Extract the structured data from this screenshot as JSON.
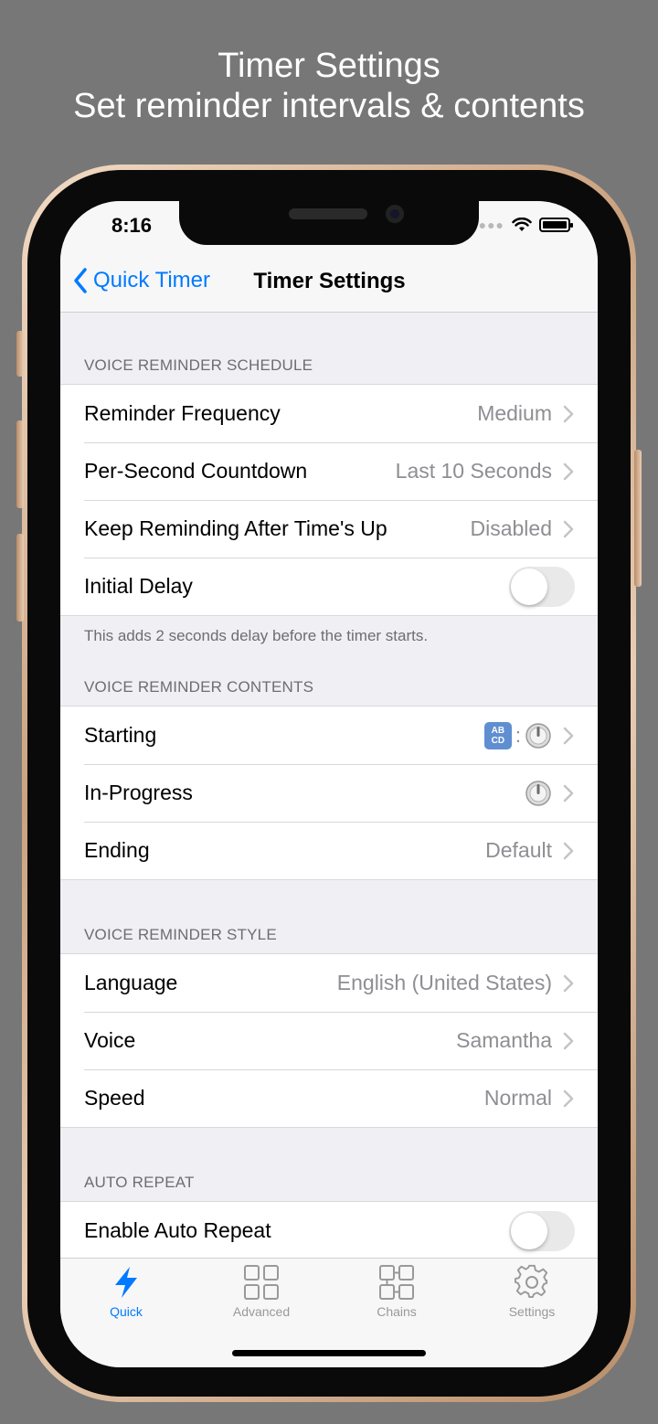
{
  "caption": {
    "line1": "Timer Settings",
    "line2": "Set reminder intervals & contents"
  },
  "status_bar": {
    "time": "8:16"
  },
  "nav": {
    "back_label": "Quick Timer",
    "title": "Timer Settings"
  },
  "sections": {
    "schedule": {
      "header": "VOICE REMINDER SCHEDULE",
      "rows": [
        {
          "label": "Reminder Frequency",
          "value": "Medium"
        },
        {
          "label": "Per-Second Countdown",
          "value": "Last 10 Seconds"
        },
        {
          "label": "Keep Reminding After Time's Up",
          "value": "Disabled"
        },
        {
          "label": "Initial Delay",
          "toggle": false
        }
      ],
      "footer": "This adds 2 seconds delay before the timer starts."
    },
    "contents": {
      "header": "VOICE REMINDER CONTENTS",
      "rows": [
        {
          "label": "Starting",
          "icons": [
            "abcd-icon",
            "gauge-icon"
          ]
        },
        {
          "label": "In-Progress",
          "icons": [
            "gauge-icon"
          ]
        },
        {
          "label": "Ending",
          "value": "Default"
        }
      ],
      "abcd_text_top": "AB",
      "abcd_text_bottom": "CD",
      "separator": ":"
    },
    "style": {
      "header": "VOICE REMINDER STYLE",
      "rows": [
        {
          "label": "Language",
          "value": "English (United States)"
        },
        {
          "label": "Voice",
          "value": "Samantha"
        },
        {
          "label": "Speed",
          "value": "Normal"
        }
      ]
    },
    "auto_repeat": {
      "header": "AUTO REPEAT",
      "rows": [
        {
          "label": "Enable Auto Repeat",
          "toggle": false
        }
      ]
    }
  },
  "tabbar": {
    "tabs": [
      {
        "label": "Quick",
        "icon": "lightning-icon",
        "active": true
      },
      {
        "label": "Advanced",
        "icon": "grid-icon",
        "active": false
      },
      {
        "label": "Chains",
        "icon": "chain-grid-icon",
        "active": false
      },
      {
        "label": "Settings",
        "icon": "gear-icon",
        "active": false
      }
    ]
  },
  "colors": {
    "accent": "#007aff",
    "background": "#efeff4",
    "secondary_text": "#8e8e93"
  }
}
